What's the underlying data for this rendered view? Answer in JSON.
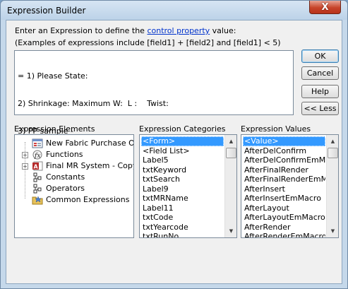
{
  "window": {
    "title": "Expression Builder",
    "close_label": "X"
  },
  "intro": {
    "line1_pre": "Enter an Expression to define the ",
    "line1_link": "control property",
    "line1_post": " value:",
    "line2": "(Examples of expressions include [field1] + [field2] and [field1] < 5)"
  },
  "expression": {
    "lines": [
      "= 1) Please State:",
      "2) Shrinkage: Maximum W:  L :    Twist:",
      "3) PP sample -"
    ]
  },
  "buttons": {
    "ok": "OK",
    "cancel": "Cancel",
    "help": "Help",
    "less": "<< Less"
  },
  "elements": {
    "label": "Expression Elements",
    "items": [
      {
        "label": "New Fabric Purchase Orde",
        "icon": "form-icon",
        "expander": ""
      },
      {
        "label": "Functions",
        "icon": "function-icon",
        "expander": "+"
      },
      {
        "label": "Final MR System - Copy.ac",
        "icon": "access-database-icon",
        "expander": "+"
      },
      {
        "label": "Constants",
        "icon": "constants-icon",
        "expander": ""
      },
      {
        "label": "Operators",
        "icon": "operators-icon",
        "expander": ""
      },
      {
        "label": "Common Expressions",
        "icon": "common-expressions-icon",
        "expander": ""
      }
    ]
  },
  "categories": {
    "label": "Expression Categories",
    "items": [
      "<Form>",
      "<Field List>",
      "Label5",
      "txtKeyword",
      "txtSearch",
      "Label9",
      "txtMRName",
      "Label11",
      "txtCode",
      "txtYearcode",
      "txtRunNo"
    ]
  },
  "values": {
    "label": "Expression Values",
    "items": [
      "<Value>",
      "AfterDelConfirm",
      "AfterDelConfirmEmMacro",
      "AfterFinalRender",
      "AfterFinalRenderEmMacr",
      "AfterInsert",
      "AfterInsertEmMacro",
      "AfterLayout",
      "AfterLayoutEmMacro",
      "AfterRender",
      "AfterRenderEmMacro"
    ]
  },
  "colors": {
    "selection": "#3399ff",
    "link": "#0033cc",
    "close": "#c7442a"
  }
}
